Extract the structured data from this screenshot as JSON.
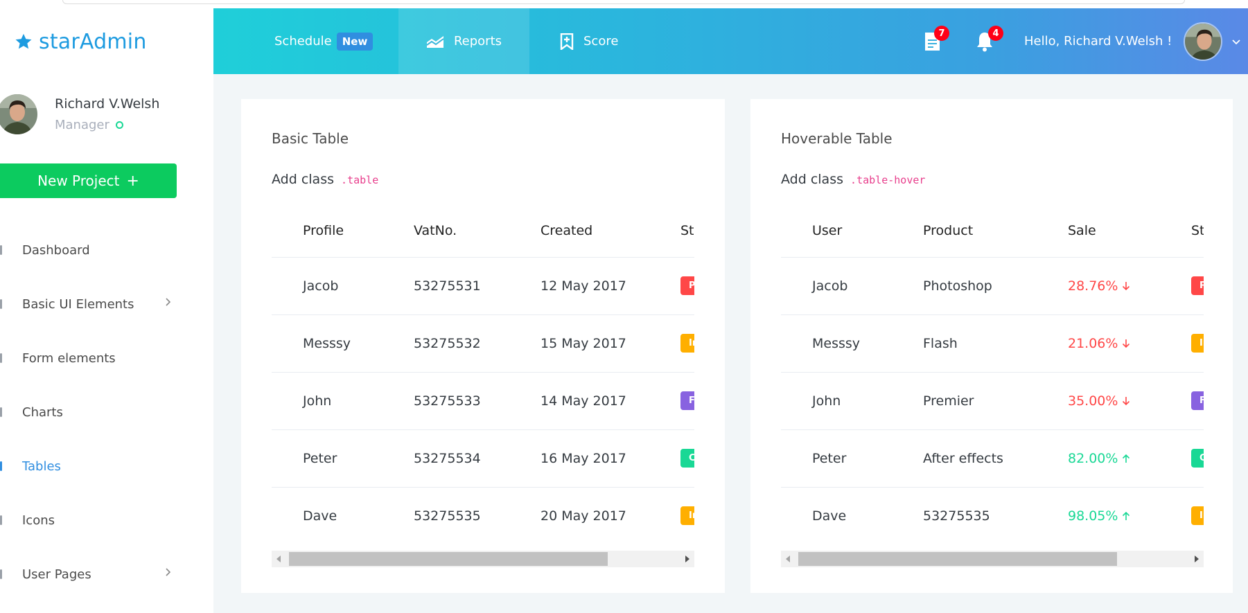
{
  "brand": {
    "name_part1": "star",
    "name_part2": "Admin",
    "icon": "star-icon",
    "color": "#1d9be0"
  },
  "sidebar": {
    "user": {
      "name": "Richard V.Welsh",
      "role": "Manager",
      "status_color": "#19d895"
    },
    "new_project": {
      "label": "New Project",
      "icon": "plus-icon",
      "color": "#0ccb5f"
    },
    "items": [
      {
        "label": "Dashboard",
        "active": false
      },
      {
        "label": "Basic UI Elements",
        "active": false,
        "has_children": true
      },
      {
        "label": "Form elements",
        "active": false
      },
      {
        "label": "Charts",
        "active": false
      },
      {
        "label": "Tables",
        "active": true
      },
      {
        "label": "Icons",
        "active": false
      },
      {
        "label": "User Pages",
        "active": false,
        "has_children": true
      }
    ]
  },
  "header": {
    "nav": [
      {
        "label": "Schedule",
        "badge": "New"
      },
      {
        "label": "Reports",
        "icon": "chart-area-icon"
      },
      {
        "label": "Score",
        "icon": "bookmark-plus-icon"
      }
    ],
    "messages_count": "7",
    "notifications_count": "4",
    "greeting": "Hello, Richard V.Welsh !",
    "gradient": [
      "#1fcfd9",
      "#5a89e6"
    ]
  },
  "basic_table": {
    "title": "Basic Table",
    "sub_text": "Add class",
    "sub_code": ".table",
    "columns": [
      "Profile",
      "VatNo.",
      "Created",
      "Status"
    ],
    "rows": [
      {
        "profile": "Jacob",
        "vat": "53275531",
        "created": "12 May 2017",
        "status": "Pending",
        "status_color": "#ff4747"
      },
      {
        "profile": "Messsy",
        "vat": "53275532",
        "created": "15 May 2017",
        "status": "In progress",
        "status_color": "#ffaf00"
      },
      {
        "profile": "John",
        "vat": "53275533",
        "created": "14 May 2017",
        "status": "Fixed",
        "status_color": "#8862e0"
      },
      {
        "profile": "Peter",
        "vat": "53275534",
        "created": "16 May 2017",
        "status": "Completed",
        "status_color": "#19d895"
      },
      {
        "profile": "Dave",
        "vat": "53275535",
        "created": "20 May 2017",
        "status": "In progress",
        "status_color": "#ffaf00"
      }
    ]
  },
  "hover_table": {
    "title": "Hoverable Table",
    "sub_text": "Add class",
    "sub_code": ".table-hover",
    "columns": [
      "User",
      "Product",
      "Sale",
      "Status"
    ],
    "rows": [
      {
        "user": "Jacob",
        "product": "Photoshop",
        "sale": "28.76%",
        "trend": "down",
        "status": "Pending",
        "status_color": "#ff4747"
      },
      {
        "user": "Messsy",
        "product": "Flash",
        "sale": "21.06%",
        "trend": "down",
        "status": "In progress",
        "status_color": "#ffaf00"
      },
      {
        "user": "John",
        "product": "Premier",
        "sale": "35.00%",
        "trend": "down",
        "status": "Fixed",
        "status_color": "#8862e0"
      },
      {
        "user": "Peter",
        "product": "After effects",
        "sale": "82.00%",
        "trend": "up",
        "status": "Completed",
        "status_color": "#19d895"
      },
      {
        "user": "Dave",
        "product": "53275535",
        "sale": "98.05%",
        "trend": "up",
        "status": "In progress",
        "status_color": "#ffaf00"
      }
    ],
    "trend_colors": {
      "down": "#ff4747",
      "up": "#19d895"
    }
  }
}
